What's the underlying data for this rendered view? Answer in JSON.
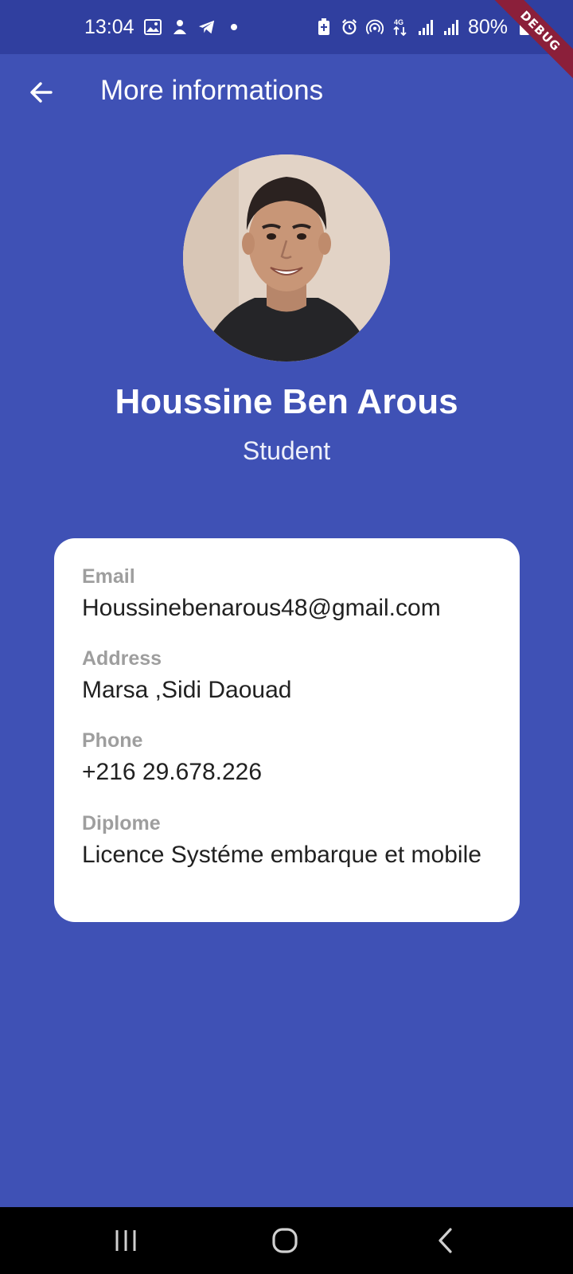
{
  "status_bar": {
    "time": "13:04",
    "battery_percent": "80%",
    "network": "4G",
    "icons_left": [
      "gallery-icon",
      "app-icon",
      "telegram-icon",
      "dot-icon"
    ],
    "icons_right": [
      "battery-saver-icon",
      "alarm-icon",
      "hotspot-icon",
      "data-arrows-icon",
      "signal-icon",
      "signal-icon",
      "battery-icon"
    ]
  },
  "debug_banner": "DEBUG",
  "app_bar": {
    "title": "More informations",
    "back_icon": "arrow-back-icon"
  },
  "profile": {
    "name": "Houssine Ben Arous",
    "role": "Student"
  },
  "info": {
    "email_label": "Email",
    "email_value": "Houssinebenarous48@gmail.com",
    "address_label": "Address",
    "address_value": "Marsa ,Sidi Daouad",
    "phone_label": "Phone",
    "phone_value": "+216 29.678.226",
    "diplome_label": "Diplome",
    "diplome_value": "Licence Systéme embarque et mobile"
  },
  "nav_bar": {
    "icons": [
      "recent-apps-icon",
      "home-icon",
      "back-icon"
    ]
  },
  "colors": {
    "primary": "#3f51b5",
    "status_bar": "#303f9f",
    "card": "#ffffff",
    "label": "#9e9e9e",
    "value": "#212121",
    "debug": "#8b1f3a"
  }
}
